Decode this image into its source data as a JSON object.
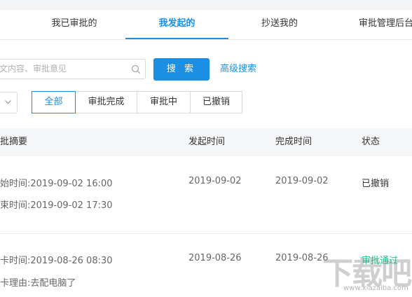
{
  "tabs": [
    {
      "label": "我已审批的",
      "active": false
    },
    {
      "label": "我发起的",
      "active": true
    },
    {
      "label": "抄送我的",
      "active": false
    },
    {
      "label": "审批管理后台",
      "active": false
    }
  ],
  "search": {
    "placeholder": "文内容、审批意见",
    "button_label": "搜 索",
    "advanced_label": "高级搜索"
  },
  "filters": [
    {
      "label": "全部",
      "active": true
    },
    {
      "label": "审批完成",
      "active": false
    },
    {
      "label": "审批中",
      "active": false
    },
    {
      "label": "已撤销",
      "active": false
    }
  ],
  "table": {
    "headers": [
      "批摘要",
      "发起时间",
      "完成时间",
      "状态"
    ],
    "rows": [
      {
        "summary": [
          "始时间:2019-09-02 16:00",
          "束时间:2019-09-02 17:30"
        ],
        "start": "2019-09-02",
        "end": "2019-09-02",
        "status": "已撤销"
      },
      {
        "summary": [
          "卡时间:2019-08-26 08:30",
          "卡理由:去配电脑了"
        ],
        "start": "2019-08-26",
        "end": "2019-08-26",
        "status": "审批通过"
      }
    ]
  },
  "watermark": {
    "text": "下载吧",
    "url": "www.xiazaiba.com"
  },
  "colors": {
    "accent": "#1a8fe3",
    "success": "#1ec28b",
    "header_bg": "#f5f6f8"
  }
}
